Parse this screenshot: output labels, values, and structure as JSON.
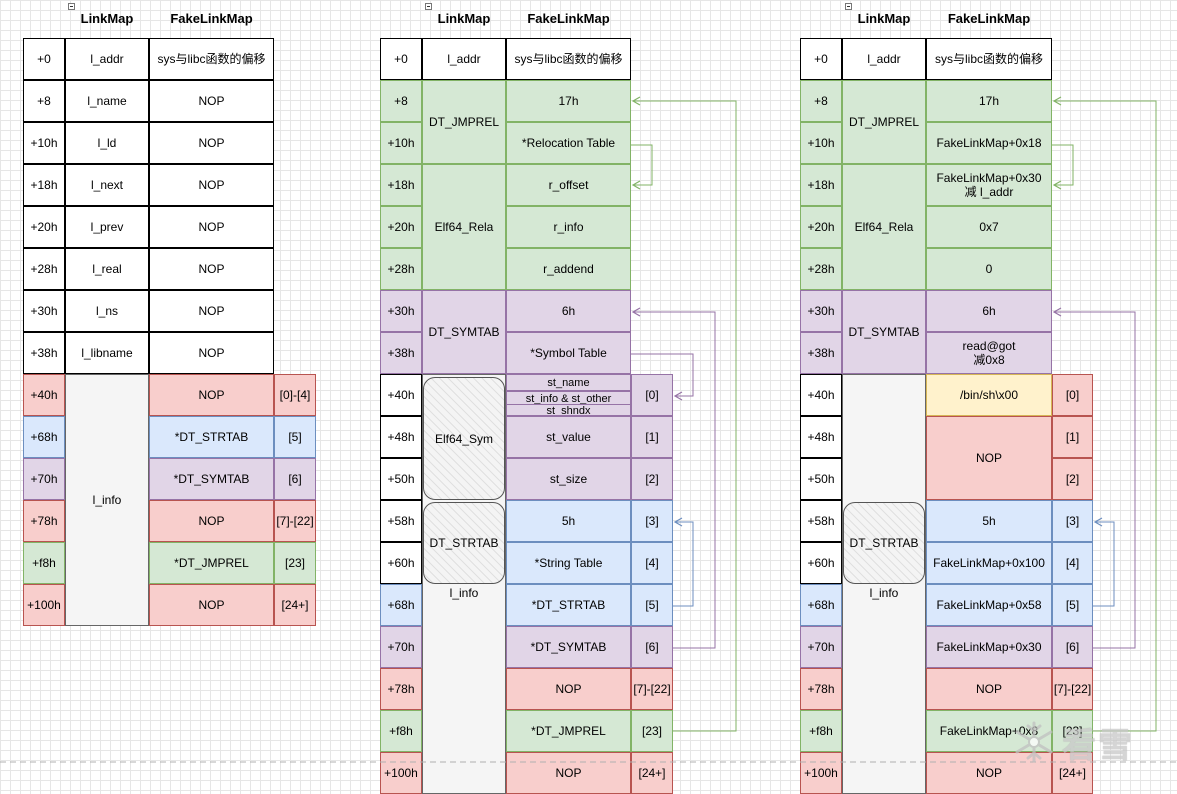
{
  "headers": {
    "linkmap": "LinkMap",
    "fakelinkmap": "FakeLinkMap"
  },
  "offsets": [
    "+0",
    "+8",
    "+10h",
    "+18h",
    "+20h",
    "+28h",
    "+30h",
    "+38h",
    "+40h",
    "+48h",
    "+50h",
    "+58h",
    "+60h",
    "+68h",
    "+70h",
    "+78h",
    "+f8h",
    "+100h"
  ],
  "table1": {
    "offsets": [
      "+0",
      "+8",
      "+10h",
      "+18h",
      "+20h",
      "+28h",
      "+30h",
      "+38h",
      "+40h",
      "+68h",
      "+70h",
      "+78h",
      "+f8h",
      "+100h"
    ],
    "linkmap": [
      "l_addr",
      "l_name",
      "l_ld",
      "l_next",
      "l_prev",
      "l_real",
      "l_ns",
      "l_libname",
      "l_info"
    ],
    "fake": [
      "sys与libc函数的偏移",
      "NOP",
      "NOP",
      "NOP",
      "NOP",
      "NOP",
      "NOP",
      "NOP",
      "NOP",
      "*DT_STRTAB",
      "*DT_SYMTAB",
      "NOP",
      "*DT_JMPREL",
      "NOP"
    ],
    "indices": [
      "[0]-[4]",
      "[5]",
      "[6]",
      "[7]-[22]",
      "[23]",
      "[24+]"
    ]
  },
  "table2": {
    "groups": [
      "l_addr",
      "DT_JMPREL",
      "Elf64_Rela",
      "DT_SYMTAB",
      "Elf64_Sym",
      "DT_STRTAB",
      "l_info"
    ],
    "fake": [
      "sys与libc函数的偏移",
      "17h",
      "*Relocation Table",
      "r_offset",
      "r_info",
      "r_addend",
      "6h",
      "*Symbol Table",
      "st_name",
      "st_info & st_other",
      "st_shndx",
      "st_value",
      "st_size",
      "5h",
      "*String Table",
      "*DT_STRTAB",
      "*DT_SYMTAB",
      "NOP",
      "*DT_JMPREL",
      "NOP"
    ],
    "indices": [
      "[0]",
      "[1]",
      "[2]",
      "[3]",
      "[4]",
      "[5]",
      "[6]",
      "[7]-[22]",
      "[23]",
      "[24+]"
    ]
  },
  "table3": {
    "groups": [
      "l_addr",
      "DT_JMPREL",
      "Elf64_Rela",
      "DT_SYMTAB",
      "DT_STRTAB",
      "l_info"
    ],
    "fake": [
      "sys与libc函数的偏移",
      "17h",
      "FakeLinkMap+0x18",
      "FakeLinkMap+0x30\n减 l_addr",
      "0x7",
      "0",
      "6h",
      "read@got\n减0x8",
      "/bin/sh\\x00",
      "NOP",
      "5h",
      "FakeLinkMap+0x100",
      "FakeLinkMap+0x58",
      "FakeLinkMap+0x30",
      "NOP",
      "FakeLinkMap+0x8",
      "NOP"
    ],
    "indices": [
      "[0]",
      "[1]",
      "[2]",
      "[3]",
      "[4]",
      "[5]",
      "[6]",
      "[7]-[22]",
      "[23]",
      "[24+]"
    ]
  },
  "colors": {
    "green_arrow": "#82b366",
    "purple_arrow": "#9673a6",
    "blue_arrow": "#6c8ebf"
  },
  "watermark": {
    "icon": "snowflake-icon",
    "text": "看雪"
  }
}
